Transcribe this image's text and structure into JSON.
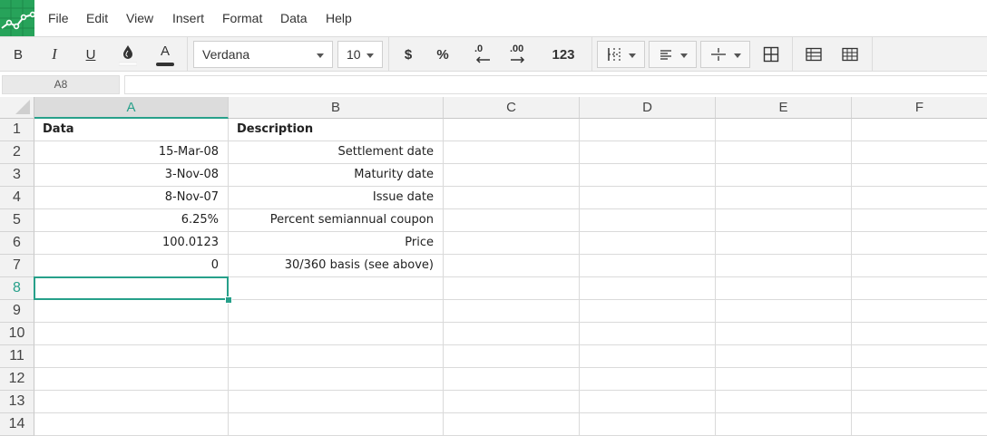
{
  "menu": [
    "File",
    "Edit",
    "View",
    "Insert",
    "Format",
    "Data",
    "Help"
  ],
  "toolbar": {
    "bold": "B",
    "italic": "I",
    "underline": "U",
    "font_color_glyph": "A",
    "font_family": "Verdana",
    "font_size": "10",
    "currency": "$",
    "percent": "%",
    "decrease_decimal": ".0",
    "increase_decimal": ".00",
    "number_format": "123"
  },
  "formula_bar": {
    "name_box": "A8",
    "formula": ""
  },
  "columns": [
    "A",
    "B",
    "C",
    "D",
    "E",
    "F"
  ],
  "rows": [
    "1",
    "2",
    "3",
    "4",
    "5",
    "6",
    "7",
    "8",
    "9",
    "10",
    "11",
    "12",
    "13",
    "14"
  ],
  "active_cell": "A8",
  "cells": [
    [
      "Data",
      "Description",
      "",
      "",
      "",
      ""
    ],
    [
      "15-Mar-08",
      "Settlement date",
      "",
      "",
      "",
      ""
    ],
    [
      "3-Nov-08",
      "Maturity date",
      "",
      "",
      "",
      ""
    ],
    [
      "8-Nov-07",
      "Issue date",
      "",
      "",
      "",
      ""
    ],
    [
      "6.25%",
      "Percent semiannual coupon",
      "",
      "",
      "",
      ""
    ],
    [
      "100.0123",
      "Price",
      "",
      "",
      "",
      ""
    ],
    [
      "0",
      "30/360 basis (see above)",
      "",
      "",
      "",
      ""
    ]
  ],
  "colors": {
    "accent": "#27a08a",
    "logo": "#27a35a"
  }
}
